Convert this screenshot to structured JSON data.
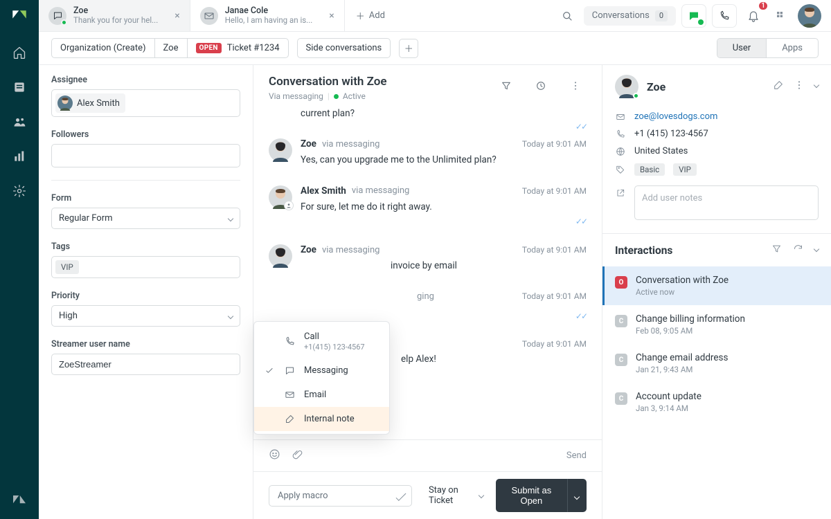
{
  "tabs": [
    {
      "title": "Zoe",
      "subtitle": "Thank you for your hel...",
      "kind": "messaging",
      "active": true
    },
    {
      "title": "Janae Cole",
      "subtitle": "Hello, I am having an is...",
      "kind": "email",
      "active": false
    }
  ],
  "addTab": "Add",
  "topbar": {
    "conversations_label": "Conversations",
    "conversations_count": "0",
    "bell_count": "1"
  },
  "pills": {
    "org": "Organization (Create)",
    "user": "Zoe",
    "status": "OPEN",
    "ticket": "Ticket #1234",
    "side": "Side conversations",
    "toggle_user": "User",
    "toggle_apps": "Apps"
  },
  "left": {
    "assignee_label": "Assignee",
    "assignee_name": "Alex Smith",
    "followers_label": "Followers",
    "form_label": "Form",
    "form_value": "Regular Form",
    "tags_label": "Tags",
    "tags": [
      "VIP"
    ],
    "priority_label": "Priority",
    "priority_value": "High",
    "streamer_label": "Streamer user name",
    "streamer_value": "ZoeStreamer"
  },
  "conversation": {
    "title": "Conversation with Zoe",
    "via": "Via messaging",
    "status": "Active",
    "orphan_line": "current plan?",
    "messages": [
      {
        "from": "Zoe",
        "via": "via messaging",
        "time": "Today at 9:01 AM",
        "body": "Yes, can you upgrade me to the Unlimited plan?",
        "agent": false,
        "checks": false
      },
      {
        "from": "Alex Smith",
        "via": "via messaging",
        "time": "Today at 9:01 AM",
        "body": "For sure, let me do it right away.",
        "agent": true,
        "checks": true
      },
      {
        "from": "Zoe",
        "via": "via messaging",
        "time": "Today at 9:01 AM",
        "body": "invoice by email",
        "agent": false,
        "checks": false,
        "truncatedLeft": true
      },
      {
        "from": "",
        "via": "ging",
        "time": "Today at 9:01 AM",
        "body": "",
        "agent": true,
        "checks": true,
        "hidden": true
      },
      {
        "from": "",
        "via": "",
        "time": "Today at 9:01 AM",
        "body": "elp Alex!",
        "agent": false,
        "checks": false,
        "hidden": true
      }
    ],
    "checks_top": true
  },
  "channel_popup": {
    "call_label": "Call",
    "call_number": "+1(415) 123-4567",
    "messaging_label": "Messaging",
    "messaging_selected": true,
    "email_label": "Email",
    "note_label": "Internal note"
  },
  "composer": {
    "channel": "Messaging",
    "send": "Send"
  },
  "footer": {
    "apply_macro": "Apply macro",
    "stay": "Stay on Ticket",
    "submit": "Submit as Open"
  },
  "customer": {
    "name": "Zoe",
    "email": "zoe@lovesdogs.com",
    "phone": "+1 (415) 123-4567",
    "location": "United States",
    "tags": [
      "Basic",
      "VIP"
    ],
    "notes_placeholder": "Add user notes"
  },
  "interactions": {
    "title": "Interactions",
    "items": [
      {
        "badge": "O",
        "open": true,
        "title": "Conversation with Zoe",
        "sub": "Active now",
        "active": true
      },
      {
        "badge": "C",
        "open": false,
        "title": "Change billing information",
        "sub": "Feb 08, 9:05 AM"
      },
      {
        "badge": "C",
        "open": false,
        "title": "Change email address",
        "sub": "Jan 21, 9:43 AM"
      },
      {
        "badge": "C",
        "open": false,
        "title": "Account update",
        "sub": "Jan 3, 9:14 AM"
      }
    ]
  }
}
